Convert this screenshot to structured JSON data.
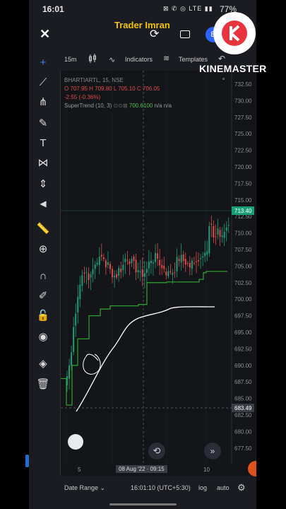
{
  "status": {
    "time": "16:01",
    "icons": "⊠ ✆ ◎ LTE ▮▮",
    "battery": "77%"
  },
  "overlay": {
    "title": "Trader Imran",
    "brand": "KINEMASTER"
  },
  "header": {
    "avatar_letter": "B"
  },
  "toolbar": {
    "timeframe": "15m",
    "indicators_label": "Indicators",
    "templates_label": "Templates"
  },
  "legend": {
    "symbol": "BHARTIARTL, 15, NSE",
    "ohlc": "O 707.95  H 709.80  L 705.10  C 706.05",
    "change": "-2.55 (-0.36%)",
    "indicator": "SuperTrend (10, 3)",
    "indicator_value": "700.6100",
    "indicator_na": "n/a  n/a"
  },
  "price_axis": {
    "labels": [
      "732.50",
      "730.00",
      "727.50",
      "725.00",
      "722.50",
      "720.00",
      "717.50",
      "715.00",
      "712.50",
      "710.00",
      "707.50",
      "705.00",
      "702.50",
      "700.00",
      "697.50",
      "695.00",
      "692.50",
      "690.00",
      "687.50",
      "685.00",
      "682.50",
      "680.00",
      "677.50"
    ],
    "last_price": "713.40",
    "crosshair_price": "683.49"
  },
  "time_axis": {
    "tick_left": "5",
    "crosshair_time": "08 Aug '22 · 09:15",
    "tick_right": "10"
  },
  "bottom": {
    "date_range": "Date Range",
    "clock": "16:01:10 (UTC+5:30)",
    "log": "log",
    "auto": "auto"
  },
  "colors": {
    "up": "#1b9e77",
    "down": "#e04b4b",
    "supertrend": "#2e9c2e",
    "accent": "#2962ff",
    "title": "#f3c300"
  }
}
